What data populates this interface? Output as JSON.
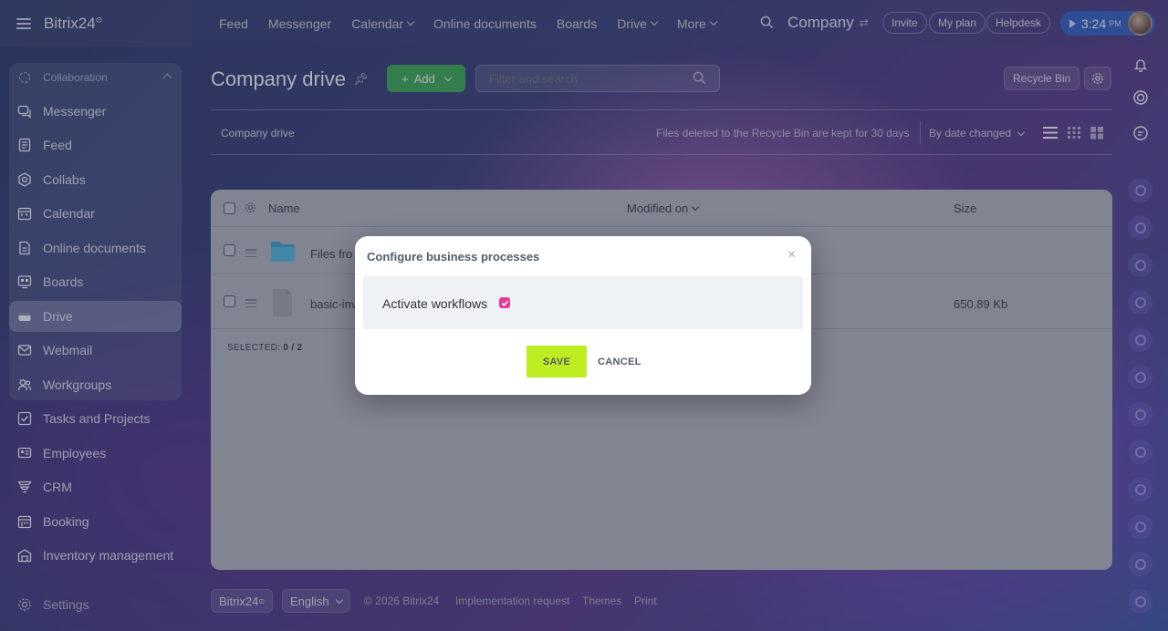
{
  "topbar": {
    "brand": "Bitrix24",
    "brand_mark": "⊙",
    "nav": [
      {
        "label": "Feed",
        "dropdown": false
      },
      {
        "label": "Messenger",
        "dropdown": false
      },
      {
        "label": "Calendar",
        "dropdown": true
      },
      {
        "label": "Online documents",
        "dropdown": false
      },
      {
        "label": "Boards",
        "dropdown": false
      },
      {
        "label": "Drive",
        "dropdown": true
      },
      {
        "label": "More",
        "dropdown": true
      }
    ],
    "company": "Company",
    "invite": "Invite",
    "my_plan": "My plan",
    "helpdesk": "Helpdesk",
    "time": "3:24",
    "time_suffix": "PM"
  },
  "sidebar": {
    "group_header": "Collaboration",
    "items": [
      {
        "label": "Messenger",
        "icon": "chat-icon"
      },
      {
        "label": "Feed",
        "icon": "feed-icon"
      },
      {
        "label": "Collabs",
        "icon": "hexagon-icon"
      },
      {
        "label": "Calendar",
        "icon": "calendar-icon"
      },
      {
        "label": "Online documents",
        "icon": "document-icon"
      },
      {
        "label": "Boards",
        "icon": "board-icon"
      },
      {
        "label": "Drive",
        "icon": "drive-icon",
        "active": true
      },
      {
        "label": "Webmail",
        "icon": "mail-icon"
      },
      {
        "label": "Workgroups",
        "icon": "group-icon"
      },
      {
        "label": "Tasks and Projects",
        "icon": "task-icon"
      },
      {
        "label": "Employees",
        "icon": "employees-icon"
      },
      {
        "label": "CRM",
        "icon": "crm-icon"
      },
      {
        "label": "Booking",
        "icon": "booking-icon"
      },
      {
        "label": "Inventory management",
        "icon": "inventory-icon"
      }
    ],
    "settings": "Settings"
  },
  "page": {
    "title": "Company drive",
    "add_label": "Add",
    "filter_placeholder": "Filter and search",
    "recycle_bin": "Recycle Bin",
    "breadcrumb": "Company drive",
    "retention_note": "Files deleted to the Recycle Bin are kept for 30 days",
    "sort_label": "By date changed"
  },
  "table": {
    "columns": {
      "name": "Name",
      "modified": "Modified on",
      "size": "Size"
    },
    "rows": [
      {
        "name": "Files fro",
        "size": "",
        "type": "folder"
      },
      {
        "name": "basic-inv",
        "size": "650.89 Kb",
        "type": "file"
      }
    ],
    "selected_label": "SELECTED:",
    "selected_value": "0 / 2"
  },
  "footer": {
    "brand": "Bitrix24",
    "language": "English",
    "copyright": "© 2026 Bitrix24",
    "links": [
      "Implementation request",
      "Themes",
      "Print"
    ]
  },
  "modal": {
    "title": "Configure business processes",
    "close": "×",
    "checkbox_label": "Activate workflows",
    "checked": true,
    "save": "SAVE",
    "cancel": "CANCEL"
  },
  "colors": {
    "add_button": "#3bb14f",
    "save_button": "#bbed21",
    "checkbox": "#e5399a",
    "time_pill": "#2a6edc"
  }
}
